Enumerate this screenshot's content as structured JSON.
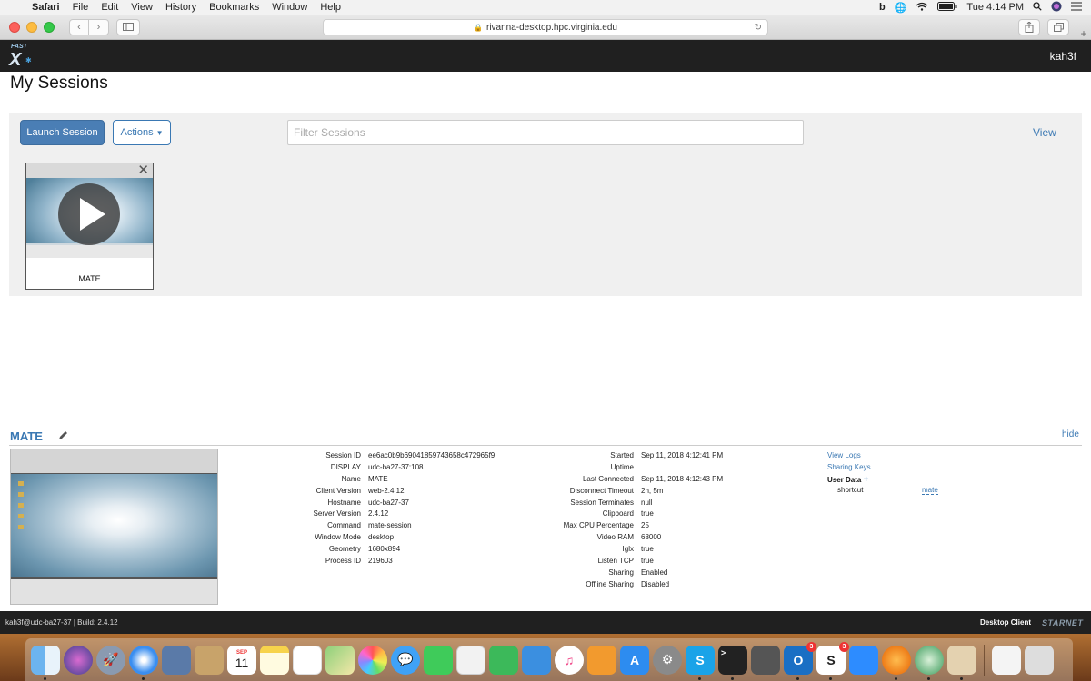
{
  "menubar": {
    "app": "Safari",
    "items": [
      "File",
      "Edit",
      "View",
      "History",
      "Bookmarks",
      "Window",
      "Help"
    ],
    "clock": "Tue 4:14 PM"
  },
  "browser": {
    "url": "rivanna-desktop.hpc.virginia.edu"
  },
  "header": {
    "logo_text": "FAST",
    "user": "kah3f"
  },
  "page": {
    "title": "My Sessions"
  },
  "toolbar": {
    "launch_label": "Launch Session",
    "actions_label": "Actions",
    "filter_placeholder": "Filter Sessions",
    "view_label": "View"
  },
  "sessions": [
    {
      "name": "MATE"
    }
  ],
  "detail": {
    "title": "MATE",
    "hide_label": "hide",
    "left": [
      {
        "key": "Session ID",
        "value": "ee6ac0b9b69041859743658c472965f9"
      },
      {
        "key": "DISPLAY",
        "value": "udc-ba27-37:108"
      },
      {
        "key": "Name",
        "value": "MATE"
      },
      {
        "key": "Client Version",
        "value": "web-2.4.12"
      },
      {
        "key": "Hostname",
        "value": "udc-ba27-37"
      },
      {
        "key": "Server Version",
        "value": "2.4.12"
      },
      {
        "key": "Command",
        "value": "mate-session"
      },
      {
        "key": "Window Mode",
        "value": "desktop"
      },
      {
        "key": "Geometry",
        "value": "1680x894"
      },
      {
        "key": "Process ID",
        "value": "219603"
      }
    ],
    "right": [
      {
        "key": "Started",
        "value": "Sep 11, 2018 4:12:41 PM"
      },
      {
        "key": "Uptime",
        "value": ""
      },
      {
        "key": "Last Connected",
        "value": "Sep 11, 2018 4:12:43 PM"
      },
      {
        "key": "Disconnect Timeout",
        "value": "2h, 5m"
      },
      {
        "key": "Session Terminates",
        "value": "null"
      },
      {
        "key": "Clipboard",
        "value": "true"
      },
      {
        "key": "Max CPU Percentage",
        "value": "25"
      },
      {
        "key": "Video RAM",
        "value": "68000"
      },
      {
        "key": "Iglx",
        "value": "true"
      },
      {
        "key": "Listen TCP",
        "value": "true"
      },
      {
        "key": "Sharing",
        "value": "Enabled"
      },
      {
        "key": "Offline Sharing",
        "value": "Disabled"
      }
    ],
    "links": {
      "view_logs": "View Logs",
      "sharing_keys": "Sharing Keys",
      "user_data": "User Data",
      "shortcut_key": "shortcut",
      "shortcut_value": "mate"
    }
  },
  "footer": {
    "build": "kah3f@udc-ba27-37 | Build: 2.4.12",
    "client": "Desktop Client",
    "brand": "STARNET"
  },
  "dock": {
    "calendar_month": "SEP",
    "calendar_day": "11",
    "mail_badge": "3",
    "slack_badge": "3"
  },
  "colors": {
    "accent": "#3a78b3",
    "launch_button": "#4a7eb5",
    "header_bg": "#202020",
    "panel_bg": "#f0f0f0"
  }
}
